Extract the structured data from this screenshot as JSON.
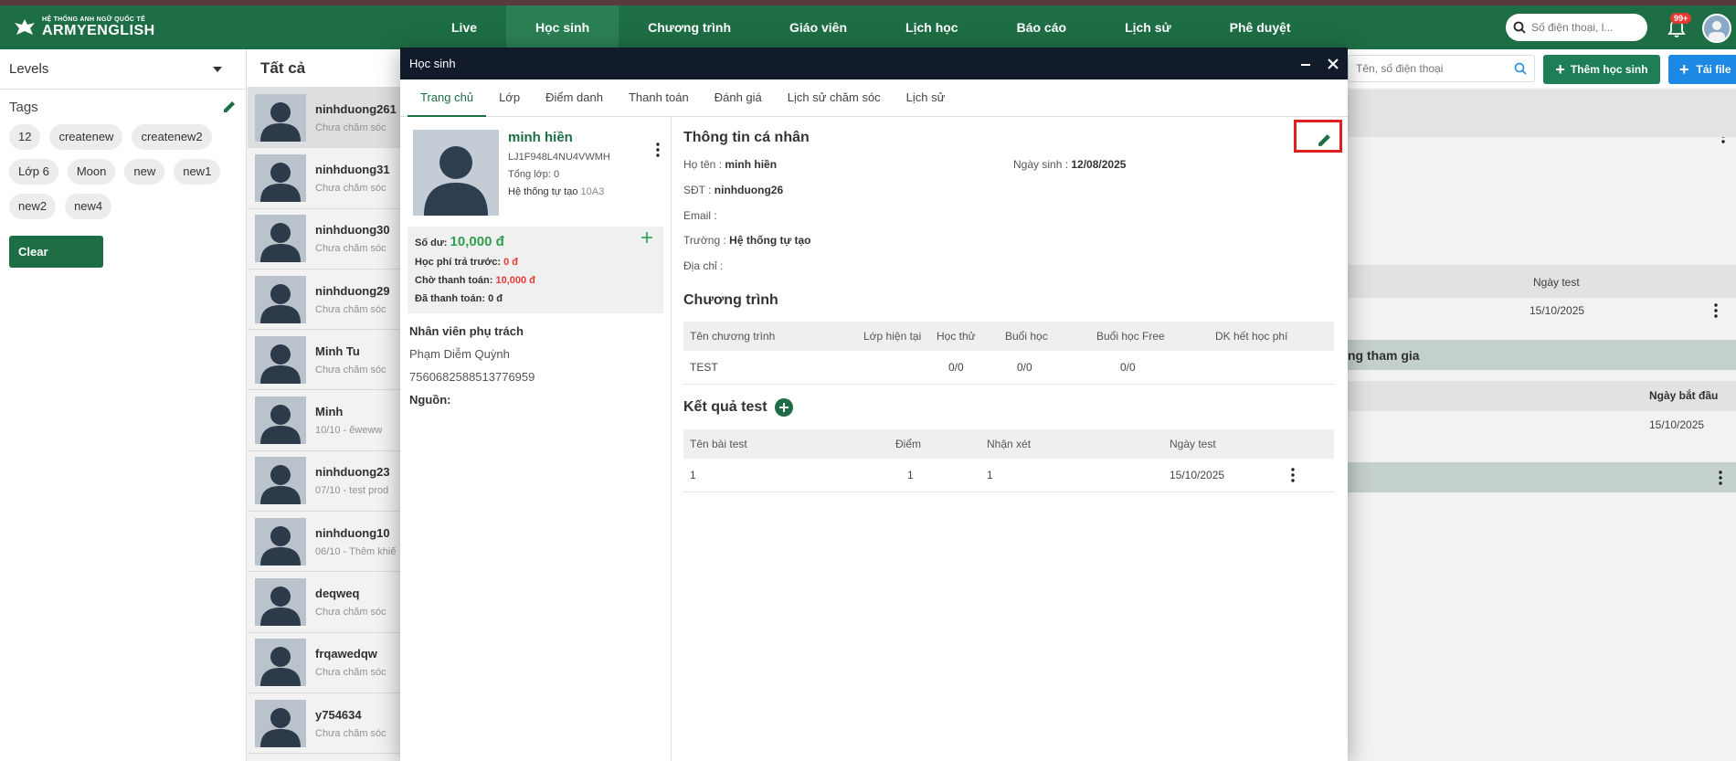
{
  "nav": {
    "logo_small": "HỆ THỐNG ANH NGỮ QUỐC TẾ",
    "logo_big": "ARMYENGLISH",
    "items": [
      "Live",
      "Học sinh",
      "Chương trình",
      "Giáo viên",
      "Lịch học",
      "Báo cáo",
      "Lịch sử",
      "Phê duyệt"
    ],
    "search_placeholder": "Số điện thoại, l...",
    "badge": "99+"
  },
  "filters": {
    "levels_label": "Levels",
    "tags_label": "Tags",
    "tags": [
      "12",
      "createnew",
      "createnew2",
      "Lớp 6",
      "Moon",
      "new",
      "new1",
      "new2",
      "new4"
    ],
    "clear_label": "Clear"
  },
  "student_list": {
    "header": "Tất cả",
    "items": [
      {
        "name": "ninhduong261",
        "sub": "Chưa chăm sóc"
      },
      {
        "name": "ninhduong31",
        "sub": "Chưa chăm sóc"
      },
      {
        "name": "ninhduong30",
        "sub": "Chưa chăm sóc"
      },
      {
        "name": "ninhduong29",
        "sub": "Chưa chăm sóc"
      },
      {
        "name": "Minh Tu",
        "sub": "Chưa chăm sóc"
      },
      {
        "name": "Minh",
        "sub": "10/10 - ếweww"
      },
      {
        "name": "ninhduong23",
        "sub": "07/10 - test prod"
      },
      {
        "name": "ninhduong10",
        "sub": "06/10 - Thêm khiế"
      },
      {
        "name": "deqweq",
        "sub": "Chưa chăm sóc"
      },
      {
        "name": "frqawedqw",
        "sub": "Chưa chăm sóc"
      },
      {
        "name": "y754634",
        "sub": "Chưa chăm sóc"
      }
    ]
  },
  "right_panel": {
    "search_placeholder": "Tên, số điện thoại",
    "add_student_label": "Thêm học sinh",
    "upload_label": "Tải file",
    "col_test_date": "Ngày test",
    "test_date_value": "15/10/2025",
    "section_join": "ng tham gia",
    "col_start_date": "Ngày bắt đầu",
    "start_date_value": "15/10/2025"
  },
  "modal": {
    "title": "Học sinh",
    "tabs": [
      "Trang chủ",
      "Lớp",
      "Điểm danh",
      "Thanh toán",
      "Đánh giá",
      "Lịch sử chăm sóc",
      "Lịch sử"
    ],
    "profile": {
      "name": "minh hiền",
      "code": "LJ1F948L4NU4VWMH",
      "total_class_label": "Tổng lớp:",
      "total_class_value": "0",
      "system_label": "Hệ thống tự tạo",
      "system_value": "10A3"
    },
    "finance": {
      "balance_label": "Số dư:",
      "balance_value": "10,000 đ",
      "prepaid_label": "Học phí trả trước:",
      "prepaid_value": "0 đ",
      "pending_label": "Chờ thanh toán:",
      "pending_value": "10,000 đ",
      "paid_label": "Đã thanh toán:",
      "paid_value": "0 đ"
    },
    "staff": {
      "title": "Nhân viên phụ trách",
      "name": "Phạm Diễm Quỳnh",
      "phone": "7560682588513776959",
      "source_label": "Nguồn:"
    },
    "personal": {
      "title": "Thông tin cá nhân",
      "fullname_label": "Họ tên :",
      "fullname_value": "minh hiền",
      "dob_label": "Ngày sinh :",
      "dob_value": "12/08/2025",
      "phone_label": "SĐT :",
      "phone_value": "ninhduong26",
      "email_label": "Email :",
      "school_label": "Trường :",
      "school_value": "Hệ thống tự tạo",
      "address_label": "Địa chỉ :"
    },
    "programs": {
      "title": "Chương trình",
      "headers": [
        "Tên chương trình",
        "Lớp hiện tại",
        "Học thử",
        "Buổi học",
        "Buổi học Free",
        "DK hết học phí"
      ],
      "rows": [
        [
          "TEST",
          "",
          "0/0",
          "0/0",
          "0/0",
          ""
        ]
      ]
    },
    "tests": {
      "title": "Kết quả test",
      "headers": [
        "Tên bài test",
        "Điểm",
        "Nhận xét",
        "Ngày test"
      ],
      "rows": [
        [
          "1",
          "1",
          "1",
          "15/10/2025"
        ]
      ]
    }
  }
}
